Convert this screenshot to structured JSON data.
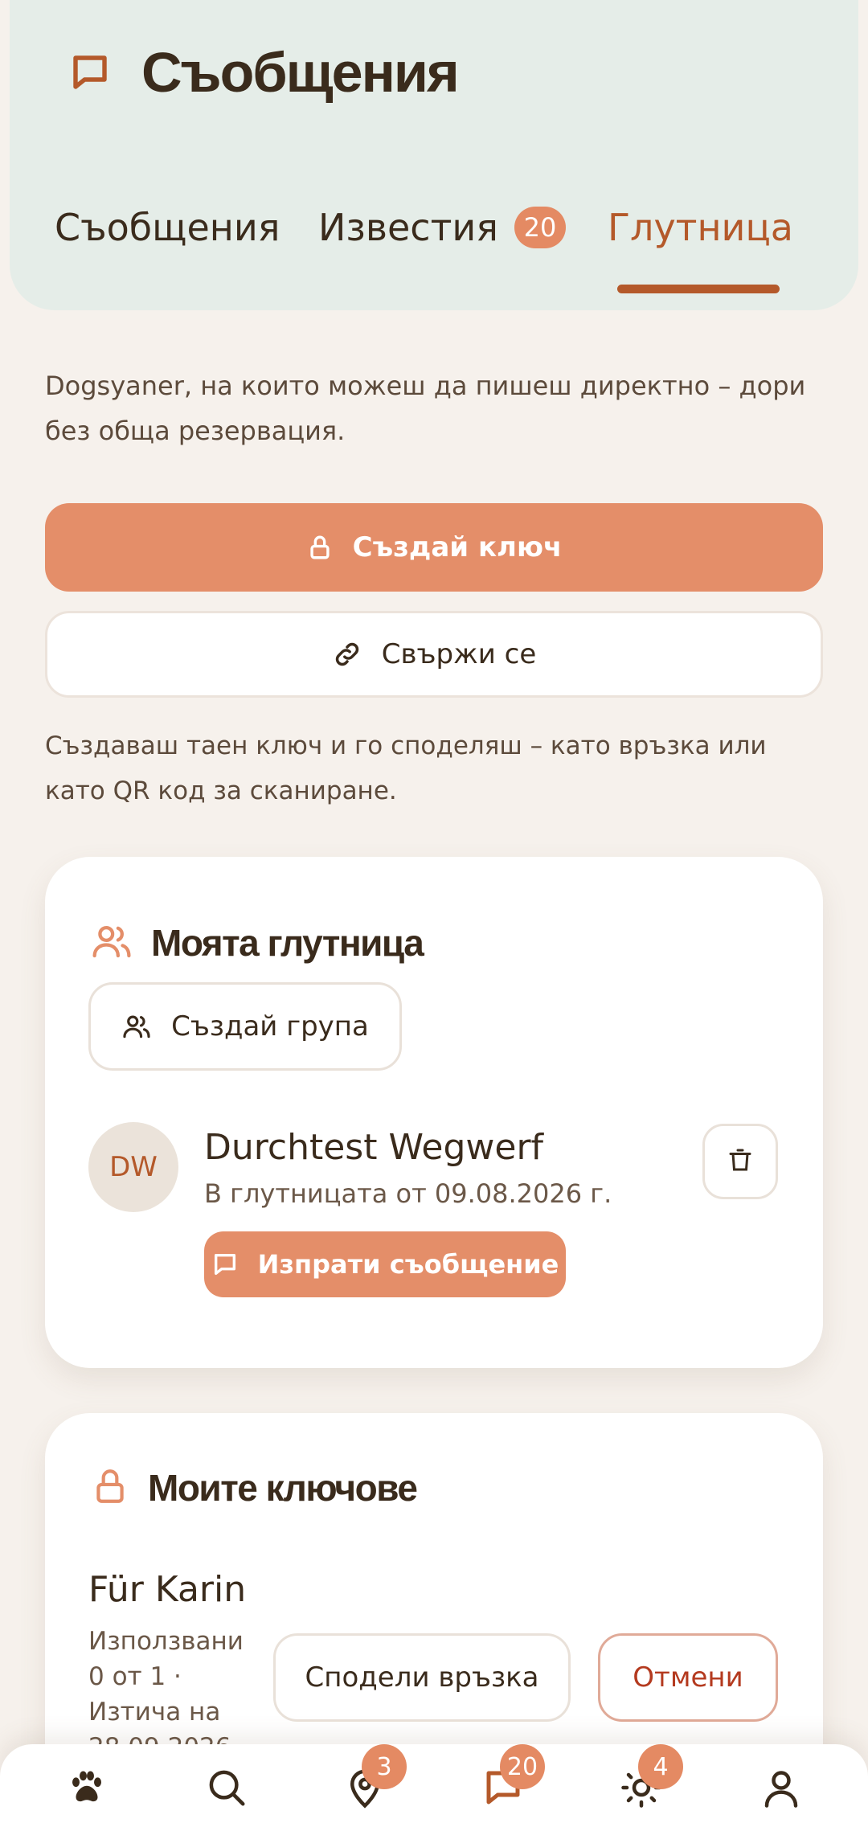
{
  "header": {
    "title": "Съобщения",
    "tabs": [
      {
        "label": "Съобщения"
      },
      {
        "label": "Известия",
        "badge": "20"
      },
      {
        "label": "Глутница"
      }
    ],
    "active_tab": "Глутница"
  },
  "intro_text": "Dogsyaner, на които можеш да пишеш директно – дори без обща резервация.",
  "actions": {
    "create_key": "Създай ключ",
    "connect": "Свържи се"
  },
  "help_text": "Създаваш таен ключ и го споделяш – като връзка или като QR код за сканиране.",
  "my_pack": {
    "title": "Моята глутница",
    "create_group": "Създай група",
    "members": [
      {
        "initials": "DW",
        "name": "Durchtest Wegwerf",
        "since": "В глутницата от 09.08.2026 г.",
        "message_button": "Изпрати съобщение"
      }
    ]
  },
  "my_keys": {
    "title": "Моите ключове",
    "keys": [
      {
        "name": "Für Karin",
        "meta": "Използвани 0 от 1 · Изтича на 28.09.2026",
        "share_button": "Сподели връзка",
        "cancel_button": "Отмени"
      }
    ]
  },
  "bottom_nav": {
    "items": [
      {
        "icon": "paw-icon"
      },
      {
        "icon": "search-icon"
      },
      {
        "icon": "map-pin-icon",
        "badge": "3"
      },
      {
        "icon": "chat-icon",
        "badge": "20"
      },
      {
        "icon": "sun-icon",
        "badge": "4"
      },
      {
        "icon": "profile-icon"
      }
    ]
  },
  "colors": {
    "accent": "#e48e69",
    "accent_dark": "#b4592a",
    "header_bg": "#e5ede8",
    "page_bg": "#f6f1ec",
    "danger": "#b43a1f"
  }
}
